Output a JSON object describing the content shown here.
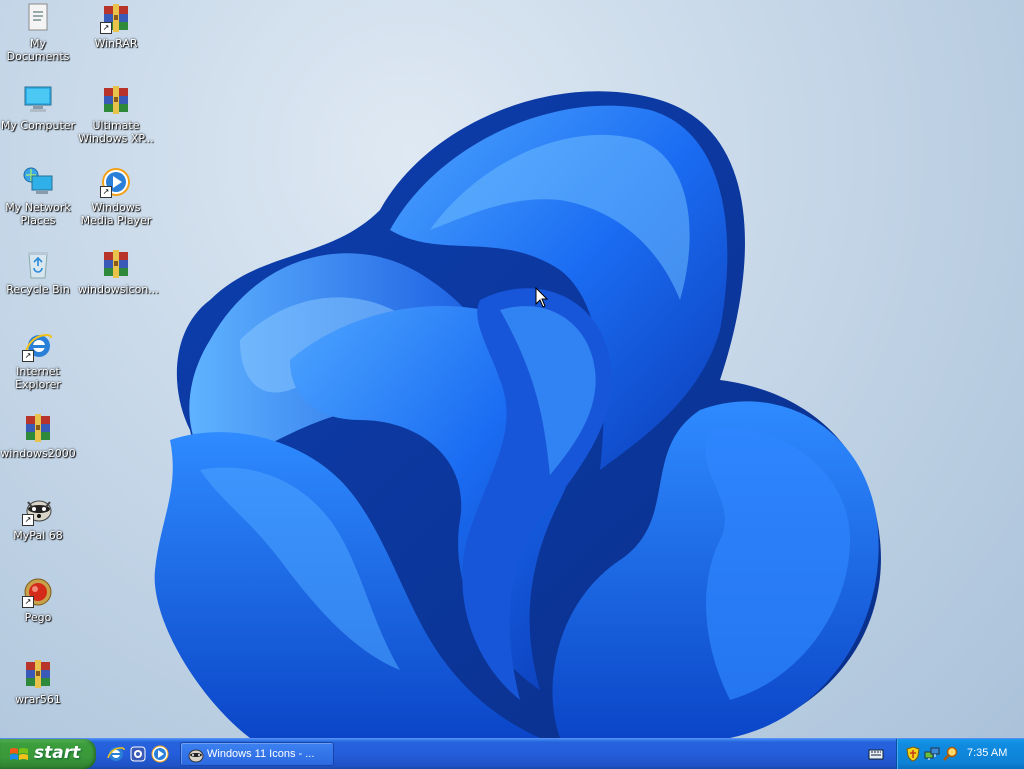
{
  "desktop_icons": [
    {
      "label": "My Documents",
      "icon": "my-documents-icon",
      "shortcut": false
    },
    {
      "label": "WinRAR",
      "icon": "winrar-icon",
      "shortcut": true
    },
    {
      "label": "My Computer",
      "icon": "my-computer-icon",
      "shortcut": false
    },
    {
      "label": "Ultimate Windows XP...",
      "icon": "winrar-archive-icon",
      "shortcut": false
    },
    {
      "label": "My Network Places",
      "icon": "network-places-icon",
      "shortcut": false
    },
    {
      "label": "Windows Media Player",
      "icon": "media-player-icon",
      "shortcut": true
    },
    {
      "label": "Recycle Bin",
      "icon": "recycle-bin-icon",
      "shortcut": false
    },
    {
      "label": "windowsicon...",
      "icon": "winrar-archive-icon",
      "shortcut": false
    },
    {
      "label": "Internet Explorer",
      "icon": "internet-explorer-icon",
      "shortcut": true
    },
    {
      "label": "windows2000",
      "icon": "winrar-archive-icon",
      "shortcut": false
    },
    {
      "label": "MyPal 68",
      "icon": "mypal-icon",
      "shortcut": true
    },
    {
      "label": "Pego",
      "icon": "pego-icon",
      "shortcut": true
    },
    {
      "label": "wrar561",
      "icon": "winrar-archive-icon",
      "shortcut": false
    }
  ],
  "taskbar": {
    "start_label": "start",
    "quick_launch": [
      "internet-explorer-icon",
      "media-center-icon",
      "media-player-icon"
    ],
    "tasks": [
      {
        "label": "Windows 11 Icons - ...",
        "icon": "mypal-icon"
      }
    ],
    "tray_icons": [
      "security-shield-icon",
      "network-icon",
      "search-icon"
    ],
    "clock": "7:35 AM"
  },
  "colors": {
    "taskbar": "#245ddb",
    "start_button": "#3a993a",
    "tray": "#0e82d6",
    "bloom": "#1a6cf0"
  }
}
